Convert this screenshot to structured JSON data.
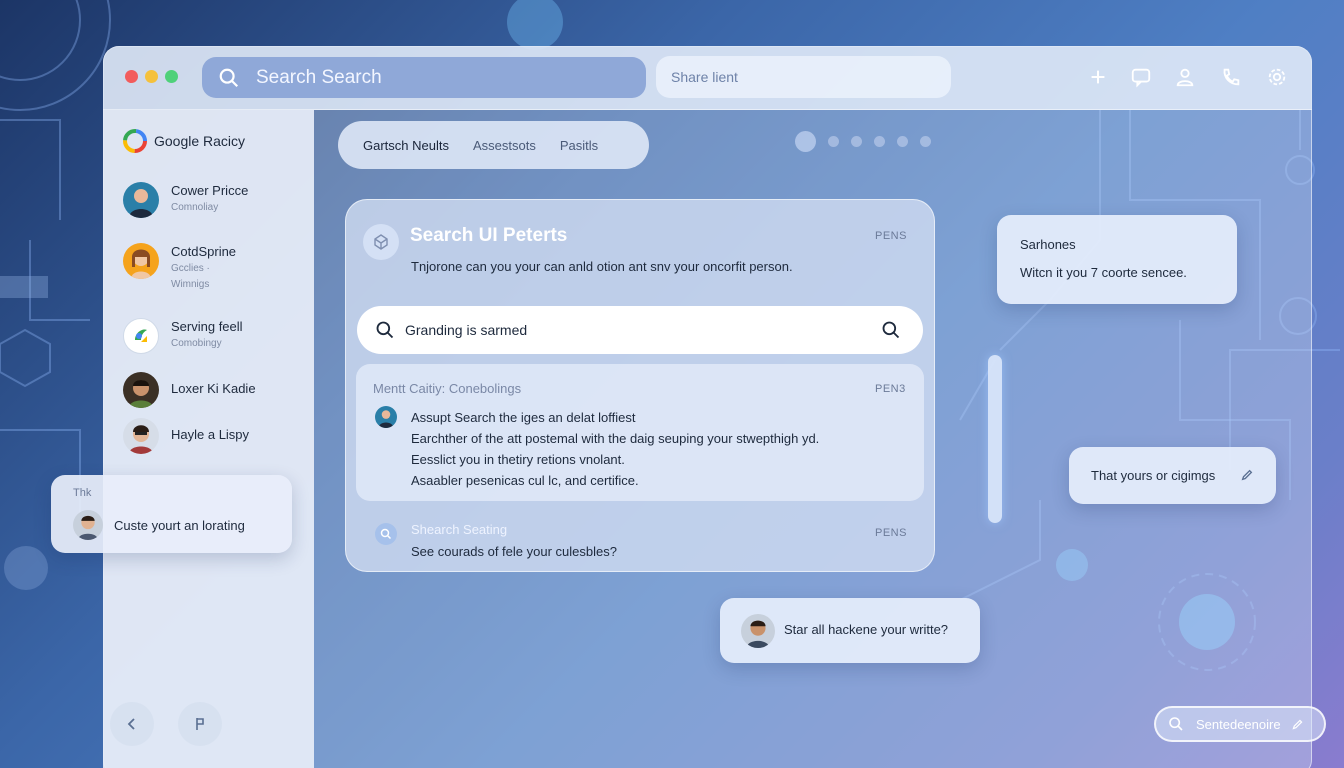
{
  "titlebar": {
    "search_text": "Search Search",
    "share_placeholder": "Share lient",
    "icons": [
      "plus-icon",
      "chat-icon",
      "user-icon",
      "phone-icon",
      "settings-icon"
    ]
  },
  "sidebar": {
    "header": "Google Racicy",
    "items": [
      {
        "name": "Cower Pricce",
        "sub": "Comnoliay"
      },
      {
        "name": "CotdSprine",
        "sub": "Gcclies ·",
        "sub2": "Wimnigs"
      },
      {
        "name": "Serving feell",
        "sub": "Comobingy"
      },
      {
        "name": "Loxer Ki Kadie",
        "sub": ""
      },
      {
        "name": "Hayle a Lispy",
        "sub": ""
      }
    ]
  },
  "float_card": {
    "label": "Thk",
    "text": "Custe yourt an lorating"
  },
  "tabs": [
    "Gartsch Neults",
    "Assestsots",
    "Pasitls"
  ],
  "panel": {
    "title": "Search UI Peterts",
    "badge": "PENS",
    "description": "Tnjorone can you your can anld otion ant snv your oncorfit person.",
    "search_value": "Granding is sarmed",
    "result": {
      "heading": "Mentt Caitiy: Conebolings",
      "badge": "PEN3",
      "lines": [
        "Assupt Search the iges an delat loffiest",
        "Earchther of the att postemal with the daig seuping your stwepthigh yd.",
        "Eesslict you in thetiry retions vnolant.",
        "Asaabler pesenicas cul lc, and certifice."
      ]
    },
    "secondary": {
      "heading": "Shearch Seating",
      "badge": "PENS",
      "text": "See courads of fele your culesbles?"
    }
  },
  "right_cards": {
    "card1": {
      "title": "Sarhones",
      "text": "Witcn it you 7 coorte sencee."
    },
    "card2": {
      "text": "That yours or cigimgs"
    },
    "card3": {
      "text": "Star all hackene your writte?"
    }
  },
  "bottom_pill": {
    "text": "Sentedeenoire"
  },
  "colors": {
    "accent": "#8fa8d8",
    "dot_red": "#f25c5c",
    "dot_yellow": "#f5c13c",
    "dot_green": "#4fd17a"
  }
}
